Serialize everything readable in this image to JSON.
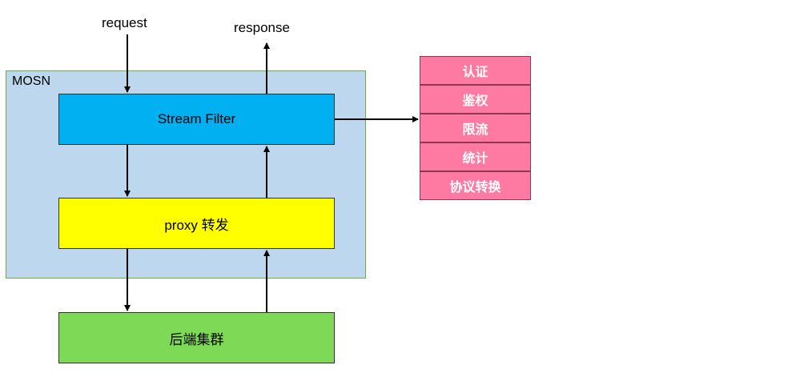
{
  "labels": {
    "request": "request",
    "response": "response"
  },
  "mosn": {
    "title": "MOSN",
    "stream_filter": "Stream Filter",
    "proxy": "proxy 转发"
  },
  "backend": {
    "label": "后端集群"
  },
  "filters": {
    "items": [
      {
        "label": "认证"
      },
      {
        "label": "鉴权"
      },
      {
        "label": "限流"
      },
      {
        "label": "统计"
      },
      {
        "label": "协议转换"
      }
    ]
  },
  "colors": {
    "mosn_background": "#bdd7ee",
    "stream_filter": "#00b0f0",
    "proxy": "#ffff00",
    "backend": "#7ed957",
    "filter_item": "#ff7aa2"
  }
}
